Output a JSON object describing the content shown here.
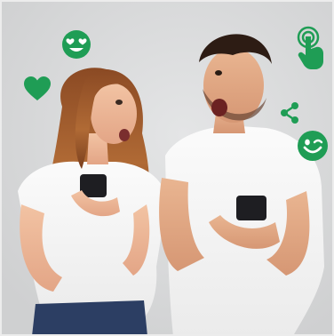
{
  "image": {
    "subject": "two-people-with-smartphones",
    "background_color": "#d9dadb"
  },
  "icons": {
    "color": "#1f9d55",
    "names": [
      "heart-eyes-icon",
      "heart-icon",
      "tap-gesture-icon",
      "share-icon",
      "wink-icon"
    ]
  }
}
